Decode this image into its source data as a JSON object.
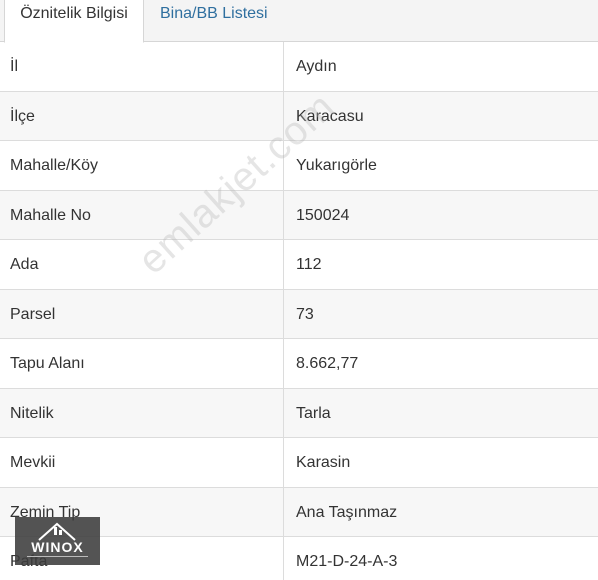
{
  "tabs": [
    {
      "label": "Öznitelik Bilgisi",
      "active": true
    },
    {
      "label": "Bina/BB Listesi",
      "active": false
    }
  ],
  "rows": [
    {
      "label": "İl",
      "value": "Aydın"
    },
    {
      "label": "İlçe",
      "value": "Karacasu"
    },
    {
      "label": "Mahalle/Köy",
      "value": "Yukarıgörle"
    },
    {
      "label": "Mahalle No",
      "value": "150024"
    },
    {
      "label": "Ada",
      "value": "112"
    },
    {
      "label": "Parsel",
      "value": "73"
    },
    {
      "label": "Tapu Alanı",
      "value": "8.662,77"
    },
    {
      "label": "Nitelik",
      "value": "Tarla"
    },
    {
      "label": "Mevkii",
      "value": "Karasin"
    },
    {
      "label": "Zemin Tip",
      "value": "Ana Taşınmaz"
    },
    {
      "label": "Pafta",
      "value": "M21-D-24-A-3"
    }
  ],
  "watermark": {
    "text": "emlakjet.com"
  },
  "logo": {
    "text": "WINOX",
    "icon": "house-icon"
  },
  "colors": {
    "tab_link": "#2f6f9f",
    "text": "#333333",
    "border": "#dcdcdc",
    "row_alt": "#f7f7f7"
  }
}
